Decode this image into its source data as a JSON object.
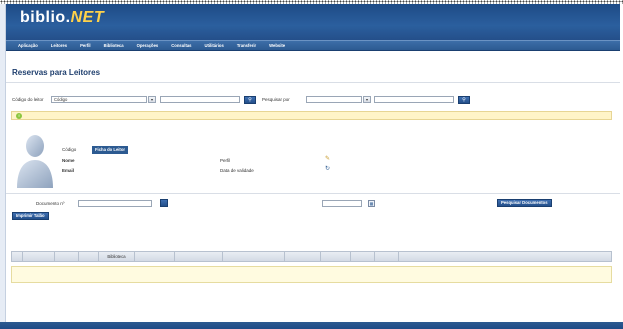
{
  "app": {
    "logo_main": "biblio.",
    "logo_net": "NET",
    "subtitle": ""
  },
  "menu": [
    "Aplicação",
    "Leitores",
    "Perfil",
    "Biblioteca",
    "Operações",
    "Consultas",
    "Utilitários",
    "Transferir",
    "Website"
  ],
  "page": {
    "title": "Reservas para Leitores"
  },
  "search": {
    "reader_code_label": "Código do leitor",
    "reader_code_type": "Código",
    "reader_code_value": "",
    "search_by_label": "Pesquisar por",
    "search_by_value": "",
    "search_text": ""
  },
  "tip": {
    "text": ""
  },
  "reader": {
    "code_label": "Código",
    "code_value": "",
    "badge": "Ficha do Leitor",
    "name_label": "Nome",
    "name_value": "",
    "email_label": "Email",
    "email_value": "",
    "profile_label": "Perfil",
    "profile_value": "",
    "validity_label": "Data de validade",
    "validity_value": ""
  },
  "reservation": {
    "document_label": "Documento nº",
    "document_value": "",
    "verify_button": "",
    "date_value": "",
    "warning": "",
    "search_docs_button": "Pesquisar Documentos",
    "print_button": "Imprimir Talão"
  },
  "movements": {
    "section_label": "",
    "columns": [
      "",
      "",
      "",
      "",
      "Biblioteca",
      "",
      "",
      "",
      "",
      "",
      "",
      ""
    ],
    "empty_text": ""
  },
  "footer": {
    "left": "",
    "right": ""
  },
  "colors": {
    "header": "#2b5f9e",
    "menubar": "#3d6ea8",
    "tip_bg": "#fff4c8",
    "warning": "#c0282d"
  }
}
